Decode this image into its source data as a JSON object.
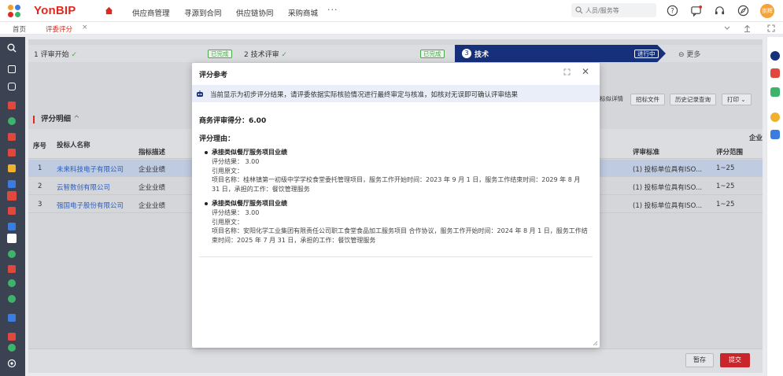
{
  "header": {
    "brand": "YonBIP",
    "nav": [
      "供应商管理",
      "寻源到合同",
      "供应链协同",
      "采购商城"
    ],
    "more": "···",
    "search_placeholder": "人员/服务等",
    "avatar_text": "崇辉"
  },
  "tabs": [
    {
      "label": "首页"
    },
    {
      "label": "评委评分",
      "close": "×"
    }
  ],
  "steps": [
    {
      "label": "1 评审开始",
      "status": "已完成"
    },
    {
      "label": "2 技术评审",
      "status": "已完成"
    },
    {
      "number": "3",
      "label": "技术",
      "status": "进行中"
    },
    {
      "label": "更多"
    }
  ],
  "actions": [
    "标似详情",
    "招标文件",
    "历史记录查询",
    "打印"
  ],
  "section": {
    "title": "评分明细",
    "toggle": "^"
  },
  "grid": {
    "headers": {
      "index": "序号",
      "bidder": "投标人名称",
      "indicator": "指标描述",
      "enterprise": "企业",
      "standard": "评审标准",
      "range": "评分范围"
    },
    "rows": [
      {
        "index": "1",
        "bidder": "未来科技电子有限公司",
        "indicator": "企业业绩",
        "standard": "(1) 投标单位具有ISO...",
        "range": "1~25"
      },
      {
        "index": "2",
        "bidder": "云智数创有限公司",
        "indicator": "企业业绩",
        "standard": "(1) 投标单位具有ISO...",
        "range": "1~25"
      },
      {
        "index": "3",
        "bidder": "强国电子股份有限公司",
        "indicator": "企业业绩",
        "standard": "(1) 投标单位具有ISO...",
        "range": "1~25"
      }
    ]
  },
  "footer": {
    "save": "暂存",
    "submit": "提交"
  },
  "modal": {
    "title": "评分参考",
    "notice": "当前显示为初步评分结果，请评委依据实际核验情况进行最终审定与核准，如核对无误即可确认评审结果",
    "score": "商务评审得分：6.00",
    "reason_label": "评分理由：",
    "items": [
      {
        "title": "承接类似餐厅服务项目业绩",
        "result": "评分结果： 3.00",
        "quote": "引用原文：",
        "detail": "项目名称：桂林镇第一初级中学学校食堂委托管理项目，服务工作开始时间：2023 年 9 月 1 日，服务工作结束时间：2029 年 8 月 31 日，承担的工作：餐饮管理服务"
      },
      {
        "title": "承接类似餐厅服务项目业绩",
        "result": "评分结果： 3.00",
        "quote": "引用原文：",
        "detail": "项目名称：安阳化学工业集团有限责任公司职工食堂食品加工服务项目 合作协议，服务工作开始时间：2024 年 8 月 1 日，服务工作结束时间：2025 年 7 月 31 日，承担的工作：餐饮管理服务"
      }
    ]
  },
  "colors": {
    "brand_red": "#e0281e",
    "step_active": "#17307c",
    "complete_green": "#4aa84a",
    "submit_red": "#c9252b",
    "left_nav": "#3b4352",
    "link_blue": "#2b5db8"
  }
}
